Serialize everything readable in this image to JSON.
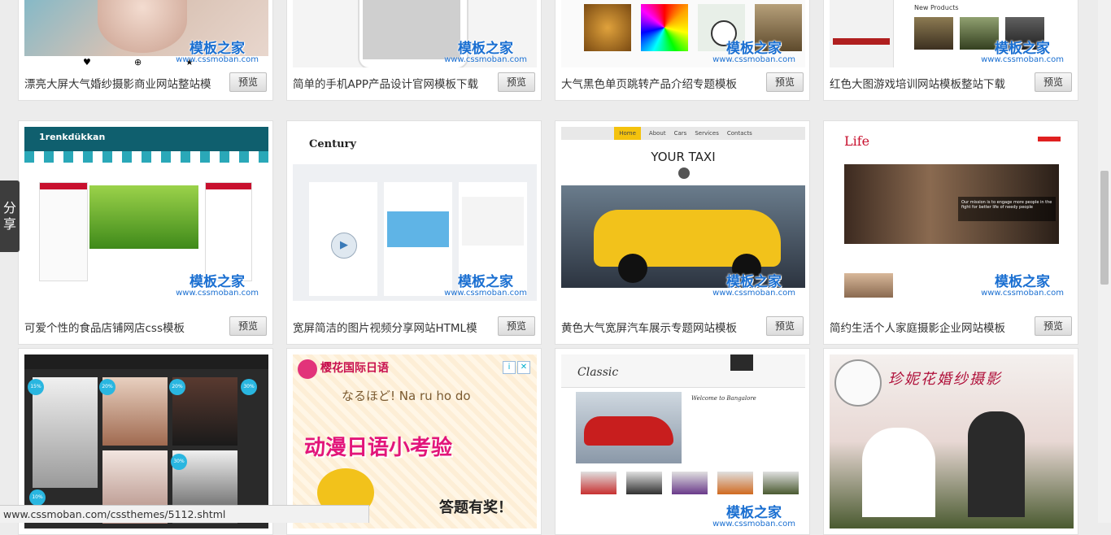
{
  "watermark": {
    "cn": "模板之家",
    "en": "www.cssmoban.com"
  },
  "row1": [
    {
      "title": "漂亮大屏大气婚纱摄影商业网站整站模",
      "button": "预览"
    },
    {
      "title": "简单的手机APP产品设计官网模板下载",
      "button": "预览"
    },
    {
      "title": "大气黑色单页跳转产品介绍专题模板",
      "button": "预览"
    },
    {
      "title": "红色大图游戏培训网站模板整站下载",
      "button": "预览",
      "thumb_text": "New Products"
    }
  ],
  "row2": [
    {
      "title": "可爱个性的食品店铺网店css模板",
      "button": "预览",
      "thumb_logo": "1renkdükkan"
    },
    {
      "title": "宽屏简洁的图片视频分享网站HTML模",
      "button": "预览",
      "thumb_logo": "Century"
    },
    {
      "title": "黄色大气宽屏汽车展示专题网站模板",
      "button": "预览",
      "thumb_nav": [
        "Home",
        "About",
        "Cars",
        "Services",
        "Contacts"
      ],
      "thumb_heading": "YOUR TAXI"
    },
    {
      "title": "简约生活个人家庭摄影企业网站模板",
      "button": "预览",
      "thumb_logo": "Life",
      "thumb_caption": "Our mission is to engage more people in the fight for better life of needy people"
    }
  ],
  "row3": [
    {
      "thumb_badges": [
        "15%",
        "20%",
        "20%",
        "30%",
        "30%",
        "10%"
      ]
    },
    {
      "ad_title": "樱花国际日语",
      "ad_sub": "なるほど! Na ru ho do",
      "ad_main": "动漫日语小考验",
      "ad_cta": "答题有奖！",
      "ad_icons": [
        "i",
        "✕"
      ]
    },
    {
      "thumb_logo": "Classic",
      "thumb_text": "Welcome to Bangalore"
    },
    {
      "thumb_text": "珍妮花婚纱摄影"
    }
  ],
  "share": {
    "label_top": "分",
    "label_bottom": "享"
  },
  "status_url": "www.cssmoban.com/cssthemes/5112.shtml"
}
